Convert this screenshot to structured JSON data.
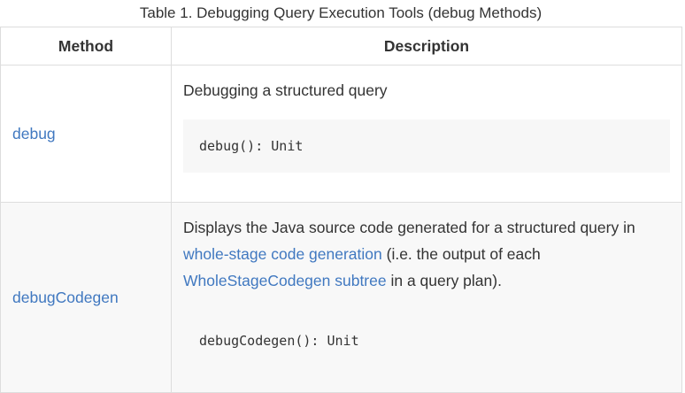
{
  "caption": "Table 1. Debugging Query Execution Tools (debug Methods)",
  "table": {
    "headers": [
      "Method",
      "Description"
    ],
    "rows": [
      {
        "method": "debug",
        "description": "Debugging a structured query",
        "code": "debug(): Unit"
      },
      {
        "method": "debugCodegen",
        "description_parts": {
          "pre": "Displays the Java source code generated for a structured query in ",
          "link1": "whole-stage code generation",
          "mid": " (i.e. the output of each ",
          "link2": "WholeStageCodegen subtree",
          "post": " in a query plan)."
        },
        "code": "debugCodegen(): Unit"
      }
    ]
  },
  "colors": {
    "link": "#4078c0",
    "text": "#333333",
    "border": "#dddddd",
    "code_background": "#f7f7f7",
    "alt_row_background": "#f8f8f8"
  }
}
